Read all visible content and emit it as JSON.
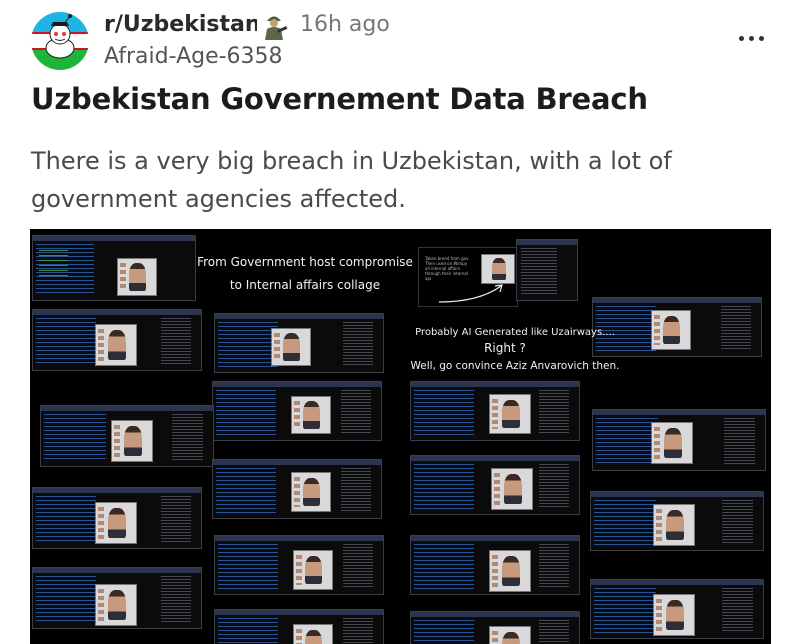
{
  "post": {
    "subreddit": "r/Uzbekistan",
    "time_ago": "16h ago",
    "author": "Afraid-Age-6358",
    "title": "Uzbekistan Governement Data Breach",
    "body": "There is a very big breach in Uzbekistan, with a lot of government agencies affected.",
    "icons": {
      "subreddit_avatar": "uzbek-flag-snoo-icon",
      "flair": "soldier-flair-icon",
      "more": "more-options-icon"
    }
  },
  "image": {
    "caption_line1": "From Government host compromise",
    "caption_line2": "to Internal affairs collage",
    "caption_line3": "Probably AI Generated like Uzairways....",
    "caption_line4": "Right ?",
    "caption_line5": "Well, go convince Aziz Anvarovich then.",
    "note_text": "Taken breed from gov. Then used on Wimpy all internal affairs through their internal api"
  },
  "colors": {
    "flag_blue": "#1eb4e3",
    "flag_white": "#ffffff",
    "flag_green": "#1eb53a",
    "flag_red": "#ce1126"
  }
}
